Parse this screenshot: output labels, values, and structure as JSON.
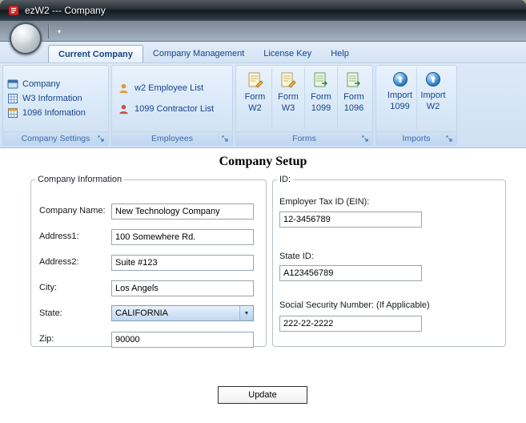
{
  "window": {
    "title": "ezW2 --- Company"
  },
  "qat": {
    "dropdown_icon": "▾"
  },
  "tabs": [
    {
      "label": "Current Company"
    },
    {
      "label": "Company Management"
    },
    {
      "label": "License Key"
    },
    {
      "label": "Help"
    }
  ],
  "groups": {
    "company_settings": {
      "label": "Company Settings",
      "items": [
        {
          "label": "Company"
        },
        {
          "label": "W3 Information"
        },
        {
          "label": "1096 Infomation"
        }
      ]
    },
    "employees": {
      "label": "Employees",
      "items": [
        {
          "label": "w2 Employee List"
        },
        {
          "label": "1099 Contractor List"
        }
      ]
    },
    "forms": {
      "label": "Forms",
      "items": [
        {
          "line1": "Form",
          "line2": "W2"
        },
        {
          "line1": "Form",
          "line2": "W3"
        },
        {
          "line1": "Form",
          "line2": "1099"
        },
        {
          "line1": "Form",
          "line2": "1096"
        }
      ]
    },
    "imports": {
      "label": "Imports",
      "items": [
        {
          "line1": "Import",
          "line2": "1099"
        },
        {
          "line1": "Import",
          "line2": "W2"
        }
      ]
    }
  },
  "content": {
    "title": "Company Setup",
    "company_information": {
      "legend": "Company Information",
      "company_name": {
        "label": "Company Name:",
        "value": "New Technology Company"
      },
      "address1": {
        "label": "Address1:",
        "value": "100 Somewhere Rd."
      },
      "address2": {
        "label": "Address2:",
        "value": "Suite #123"
      },
      "city": {
        "label": "City:",
        "value": "Los Angels"
      },
      "state": {
        "label": "State:",
        "value": "CALIFORNIA"
      },
      "zip": {
        "label": "Zip:",
        "value": "90000"
      }
    },
    "id_section": {
      "legend": "ID:",
      "ein": {
        "label": "Employer Tax ID (EIN):",
        "value": "12-3456789"
      },
      "state_id": {
        "label": "State ID:",
        "value": "A123456789"
      },
      "ssn": {
        "label": "Social Security Number: (If Applicable)",
        "value": "222-22-2222"
      }
    },
    "update_button": "Update"
  }
}
